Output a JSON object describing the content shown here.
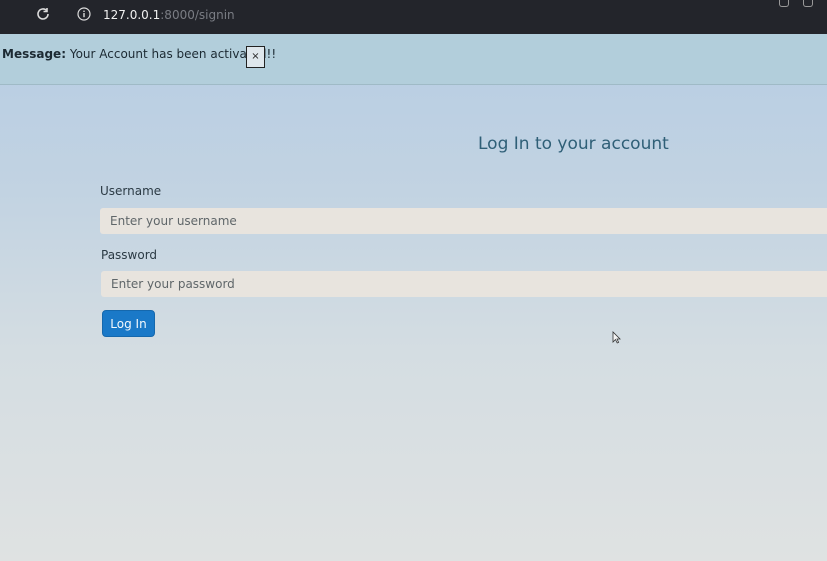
{
  "browser": {
    "url_host": "127.0.0.1",
    "url_path": ":8000/signin"
  },
  "alert": {
    "label": "Message:",
    "text": "Your Account has been activated!!",
    "close_label": "×"
  },
  "login": {
    "heading": "Log In to your account",
    "username_label": "Username",
    "username_placeholder": "Enter your username",
    "password_label": "Password",
    "password_placeholder": "Enter your password",
    "submit_label": "Log In"
  },
  "colors": {
    "button": "#1a79c8",
    "heading": "#2f5f77",
    "alert_bg": "#b2cedb"
  }
}
